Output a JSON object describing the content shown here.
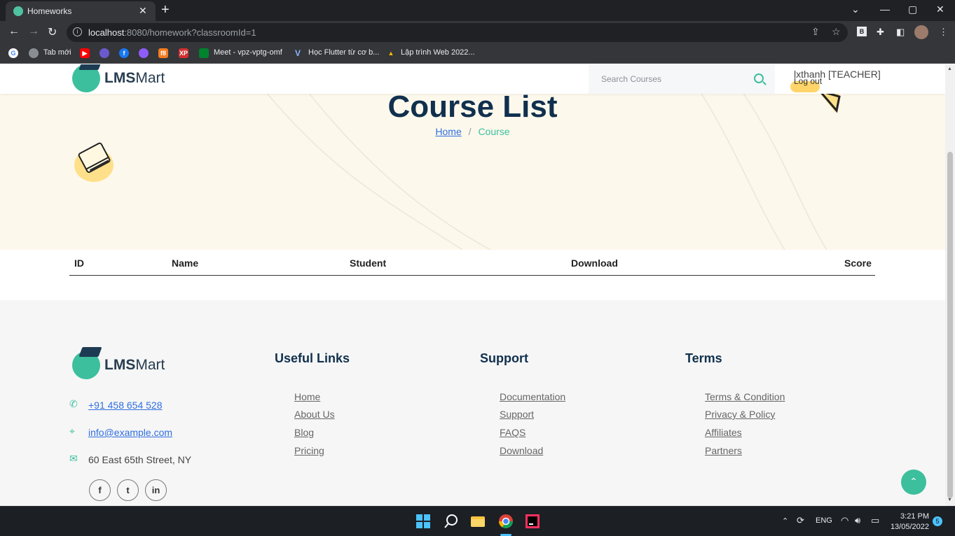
{
  "browser": {
    "tab_title": "Homeworks",
    "url_host": "localhost",
    "url_rest": ":8080/homework?classroomId=1",
    "bookmarks": [
      {
        "label": "Tab mới"
      },
      {
        "label": "Meet - vpz-vptg-omf"
      },
      {
        "label": "Học Flutter từ cơ b..."
      },
      {
        "label": "Lập trình Web 2022..."
      }
    ]
  },
  "header": {
    "logo_bold": "LMS",
    "logo_light": "Mart",
    "search_placeholder": "Search Courses",
    "user_label": "lxthanh [TEACHER]",
    "logout_label": "Log out"
  },
  "hero": {
    "title": "Course List",
    "breadcrumb_home": "Home",
    "breadcrumb_sep": "/",
    "breadcrumb_current": "Course"
  },
  "table": {
    "columns": [
      "ID",
      "Name",
      "Student",
      "Download",
      "Score"
    ],
    "rows": []
  },
  "footer": {
    "logo_bold": "LMS",
    "logo_light": "Mart",
    "phone": "+91 458 654 528",
    "email": "info@example.com",
    "address": "60 East 65th Street, NY",
    "useful_links": {
      "title": "Useful Links",
      "items": [
        "Home",
        "About Us",
        "Blog",
        "Pricing"
      ]
    },
    "support": {
      "title": "Support",
      "items": [
        "Documentation",
        "Support",
        "FAQS",
        "Download"
      ]
    },
    "terms": {
      "title": "Terms",
      "items": [
        "Terms & Condition",
        "Privacy & Policy",
        "Affiliates",
        "Partners"
      ]
    },
    "social": [
      "f",
      "t",
      "in"
    ]
  },
  "taskbar": {
    "language": "ENG",
    "time": "3:21 PM",
    "date": "13/05/2022",
    "notification_count": "5"
  },
  "colors": {
    "accent": "#3cbf9c",
    "title": "#10304d",
    "hero_bg": "#fcf8ec"
  }
}
